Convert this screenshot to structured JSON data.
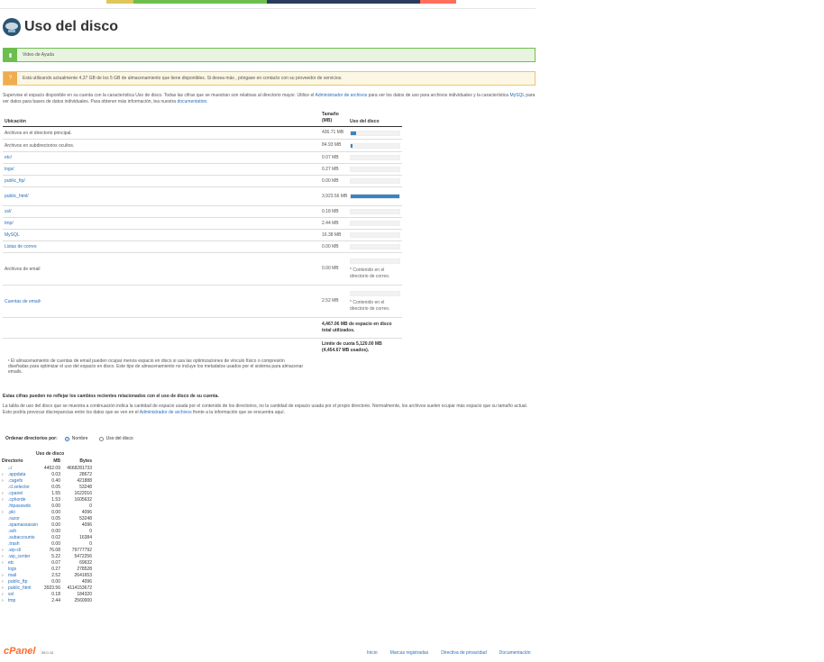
{
  "page": {
    "title": "Uso del disco",
    "help_video": "Video de Ayuda",
    "usage_notice": "Está utilizando actualmente 4,37 GB de los 5 GB de almacenamiento que tiene disponibles. Si desea más , póngase en contacto con su proveedor de servicios."
  },
  "topbar_colors": [
    "#e0c65a",
    "#6cbf4f",
    "#2c3a5e",
    "#ff6e5a"
  ],
  "description": {
    "part1": "Supervise el espacio disponible en su cuenta con la característica Uso de disco. Todas las cifras que se muestran son relativas al directorio mayor. Utilice el ",
    "link1": "Administrador de archivos",
    "part2": " para ver los datos de uso para archivos individuales y la característica ",
    "link2": "MySQL",
    "part3": " para ver datos para bases de datos individuales. Para obtener más información, lea nuestra ",
    "link3": "documentation",
    "part4": "."
  },
  "usage_table": {
    "headers": {
      "location": "Ubicación",
      "size": "Tamaño (MB)",
      "usage": "Uso del disco"
    },
    "rows": [
      {
        "location": "Archivos en el directorio principal.",
        "link": false,
        "size": "436.71 MB",
        "fill": 0.11
      },
      {
        "location": "Archivos en subdirectorios ocultos.",
        "link": false,
        "size": "84.93 MB",
        "fill": 0.02
      },
      {
        "location": "etc/",
        "link": true,
        "size": "0.07 MB",
        "fill": 0
      },
      {
        "location": "logs/",
        "link": true,
        "size": "0.27 MB",
        "fill": 0
      },
      {
        "location": "public_ftp/",
        "link": true,
        "size": "0.00 MB",
        "fill": 0
      },
      {
        "location": "public_html/",
        "link": true,
        "size": "3,923.56 MB",
        "fill": 1.0
      },
      {
        "location": "ssl/",
        "link": true,
        "size": "0.18 MB",
        "fill": 0
      },
      {
        "location": "tmp/",
        "link": true,
        "size": "2.44 MB",
        "fill": 0
      },
      {
        "location": "MySQL",
        "link": true,
        "size": "16.38 MB",
        "fill": 0
      },
      {
        "location": "Listas de correo",
        "link": true,
        "size": "0.00 MB",
        "fill": 0
      }
    ],
    "email_rows": [
      {
        "location": "Archivos de email",
        "link": false,
        "size": "0.00 MB",
        "note": "* Contenido en el directorio de correo."
      },
      {
        "location": "Cuentas de email¹",
        "link": true,
        "size": "2.52 MB",
        "note": "* Contenido en el directorio de correo."
      }
    ],
    "total_used": "4,467.06 MB de espacio en disco total utilizados.",
    "quota": "Límite de cuota 5,120.00 MB (4,454.67 MB usados)."
  },
  "footnote": "¹ El almacenamiento de cuentas de email pueden ocupar menos espacio en disco si usa las optimizaciones de vínculo físico o compresión diseñadas para optimizar el uso del espacio en disco. Este tipo de almacenamiento no incluye los metadatos usados por el sistema para almacenar emails.",
  "warning": {
    "heading": "Estas cifras pueden no reflejar los cambios recientes relacionados con el uso de disco de su cuenta.",
    "text1": "La tabla de uso del disco que se muestra a continuación indica la cantidad de espacio usada por el contenido de los directorios, no la cantidad de espacio usada por el propio directorio. Normalmente, los archivos suelen ocupar más espacio que su tamaño actual. Esto podría provocar discrepancias entre los datos que se ven en el ",
    "link": "Administrador de archivos",
    "text2": " frente a la información que se encuentra aquí."
  },
  "sort": {
    "label": "Ordenar directorios por:",
    "option1": "Nombre",
    "option2": "Uso del disco",
    "selected": "Nombre"
  },
  "dir_table": {
    "header_dir": "Directorio",
    "header_usage": "Uso de disco",
    "header_mb": "MB",
    "header_bytes": "Bytes",
    "root": {
      "mb": "4452.09",
      "bytes": "4668281733"
    },
    "rows": [
      {
        "caret": true,
        "name": ".appdata",
        "mb": "0.03",
        "bytes": "28672"
      },
      {
        "caret": true,
        "name": ".cagefs",
        "mb": "0.40",
        "bytes": "421888"
      },
      {
        "caret": false,
        "name": ".cl.selector",
        "mb": "0.05",
        "bytes": "53248"
      },
      {
        "caret": true,
        "name": ".cpanel",
        "mb": "1.55",
        "bytes": "1622016"
      },
      {
        "caret": true,
        "name": ".cphorde",
        "mb": "1.53",
        "bytes": "1605632"
      },
      {
        "caret": false,
        "name": ".htpasswds",
        "mb": "0.00",
        "bytes": "0"
      },
      {
        "caret": true,
        "name": ".pki",
        "mb": "0.00",
        "bytes": "4096"
      },
      {
        "caret": false,
        "name": ".razor",
        "mb": "0.05",
        "bytes": "53248"
      },
      {
        "caret": false,
        "name": ".spamassassin",
        "mb": "0.00",
        "bytes": "4096"
      },
      {
        "caret": false,
        "name": ".ssh",
        "mb": "0.00",
        "bytes": "0"
      },
      {
        "caret": false,
        "name": ".subaccounts",
        "mb": "0.02",
        "bytes": "16384"
      },
      {
        "caret": false,
        "name": ".trash",
        "mb": "0.00",
        "bytes": "0"
      },
      {
        "caret": true,
        "name": ".wp-cli",
        "mb": "76.08",
        "bytes": "79777792"
      },
      {
        "caret": true,
        "name": ".wp_center",
        "mb": "5.22",
        "bytes": "5472256"
      },
      {
        "caret": true,
        "name": "etc",
        "mb": "0.07",
        "bytes": "69632"
      },
      {
        "caret": false,
        "name": "logs",
        "mb": "0.27",
        "bytes": "278528"
      },
      {
        "caret": true,
        "name": "mail",
        "mb": "2.52",
        "bytes": "2641653"
      },
      {
        "caret": true,
        "name": "public_ftp",
        "mb": "0.00",
        "bytes": "4096"
      },
      {
        "caret": true,
        "name": "public_html",
        "mb": "3923.56",
        "bytes": "4114153672"
      },
      {
        "caret": true,
        "name": "ssl",
        "mb": "0.18",
        "bytes": "184320"
      },
      {
        "caret": true,
        "name": "tmp",
        "mb": "2.44",
        "bytes": "2560000"
      }
    ]
  },
  "footer": {
    "logo": "cPanel",
    "version": "98.0.15",
    "links": [
      "Inicio",
      "Marcas registradas",
      "Directiva de privacidad",
      "Documentación"
    ]
  }
}
